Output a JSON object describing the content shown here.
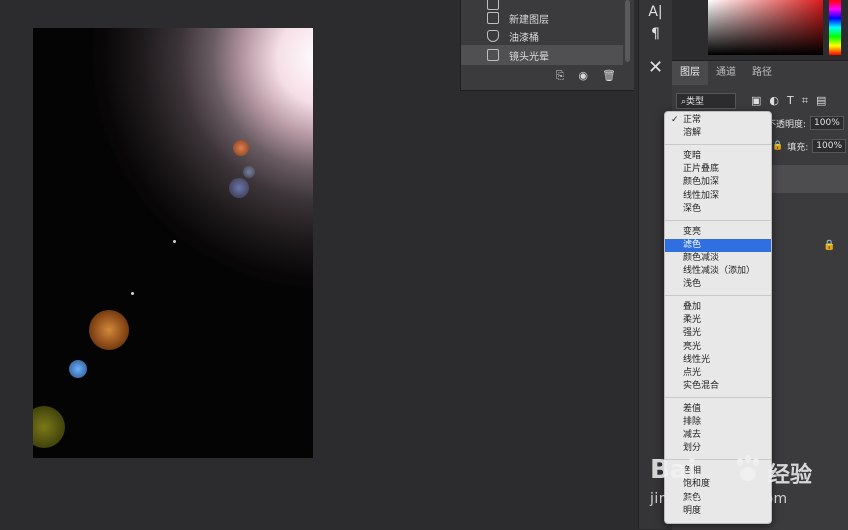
{
  "history_panel": {
    "items": [
      {
        "label": "",
        "icon": "document-icon"
      },
      {
        "label": "新建图层",
        "icon": "document-icon"
      },
      {
        "label": "油漆桶",
        "icon": "paint-bucket-icon"
      },
      {
        "label": "镜头光晕",
        "icon": "document-icon"
      }
    ],
    "tool_icons": [
      "new-snapshot-icon",
      "camera-icon",
      "trash-icon"
    ]
  },
  "tool_strip": {
    "buttons": [
      {
        "label": "A|",
        "icon": "character-panel-icon"
      },
      {
        "label": "¶",
        "icon": "paragraph-icon"
      },
      {
        "label": "✕",
        "icon": "tools-icon"
      }
    ]
  },
  "layers_panel": {
    "tabs": [
      "图层",
      "通道",
      "路径"
    ],
    "filter_label": "⌕类型",
    "opacity_label": "不透明度:",
    "opacity_value": "100%",
    "fill_label": "填充:",
    "fill_value": "100%"
  },
  "blend_menu": {
    "groups": [
      [
        "正常",
        "溶解"
      ],
      [
        "变暗",
        "正片叠底",
        "颜色加深",
        "线性加深",
        "深色"
      ],
      [
        "变亮",
        "滤色",
        "颜色减淡",
        "线性减淡（添加）",
        "浅色"
      ],
      [
        "叠加",
        "柔光",
        "强光",
        "亮光",
        "线性光",
        "点光",
        "实色混合"
      ],
      [
        "差值",
        "排除",
        "减去",
        "划分"
      ],
      [
        "色相",
        "饱和度",
        "颜色",
        "明度"
      ]
    ],
    "checked": "正常",
    "highlighted": "滤色"
  },
  "watermark": {
    "brand": "Bai",
    "brand_cn": "经验",
    "url": "jingyan.baidu.com"
  },
  "colors": {
    "background": "#2c2b2e",
    "panel": "#3b3a3d",
    "menu": "#e8e8e8",
    "highlight": "#2f6fe0"
  }
}
